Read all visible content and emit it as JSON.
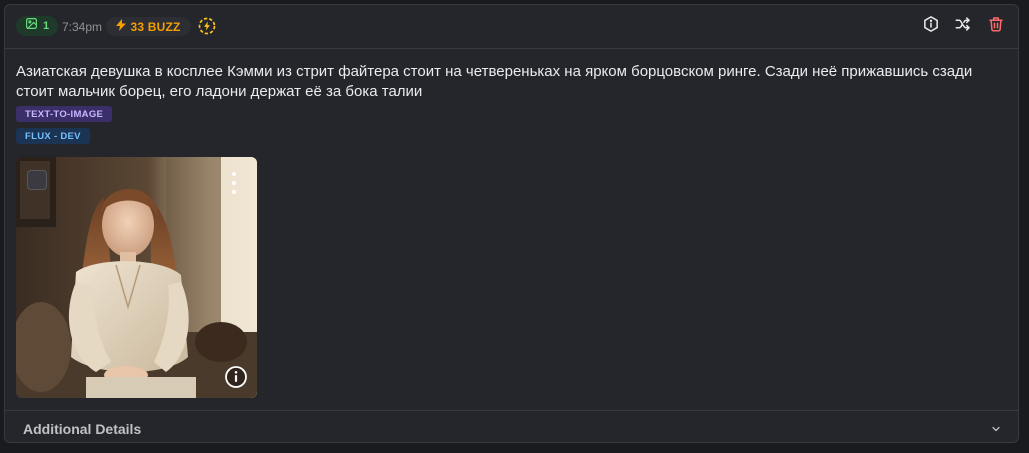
{
  "header": {
    "image_count": "1",
    "time": "7:34pm",
    "buzz": "33 BUZZ",
    "icons": {
      "image": "image-icon",
      "bolt": "bolt-icon",
      "status": "lightning-circle-icon",
      "info": "info-icon",
      "remix": "shuffle-icon",
      "delete": "trash-icon"
    }
  },
  "prompt": "Азиатская девушка в косплее Кэмми из стрит файтера стоит на четвереньках на ярком борцовском ринге. Сзади неё прижавшись сзади стоит мальчик борец, его ладони держат её за бока талии",
  "tags": {
    "type": "TEXT-TO-IMAGE",
    "model": "FLUX - DEV"
  },
  "image": {
    "alt": "Generated image: woman in cream blouse seated on a couch by a window",
    "icons": [
      "checkbox-icon",
      "more-vertical-icon",
      "info-icon"
    ]
  },
  "footer": {
    "label": "Additional Details",
    "icon": "chevron-down-icon"
  },
  "colors": {
    "background": "#1a1b1e",
    "card": "#25262b",
    "border": "#373a40",
    "buzz": "#f59f00",
    "green_badge": "#69db7c",
    "tag_purple": "#c9b6ff",
    "tag_blue": "#74c0fc",
    "delete_red": "#ff6b6b"
  }
}
